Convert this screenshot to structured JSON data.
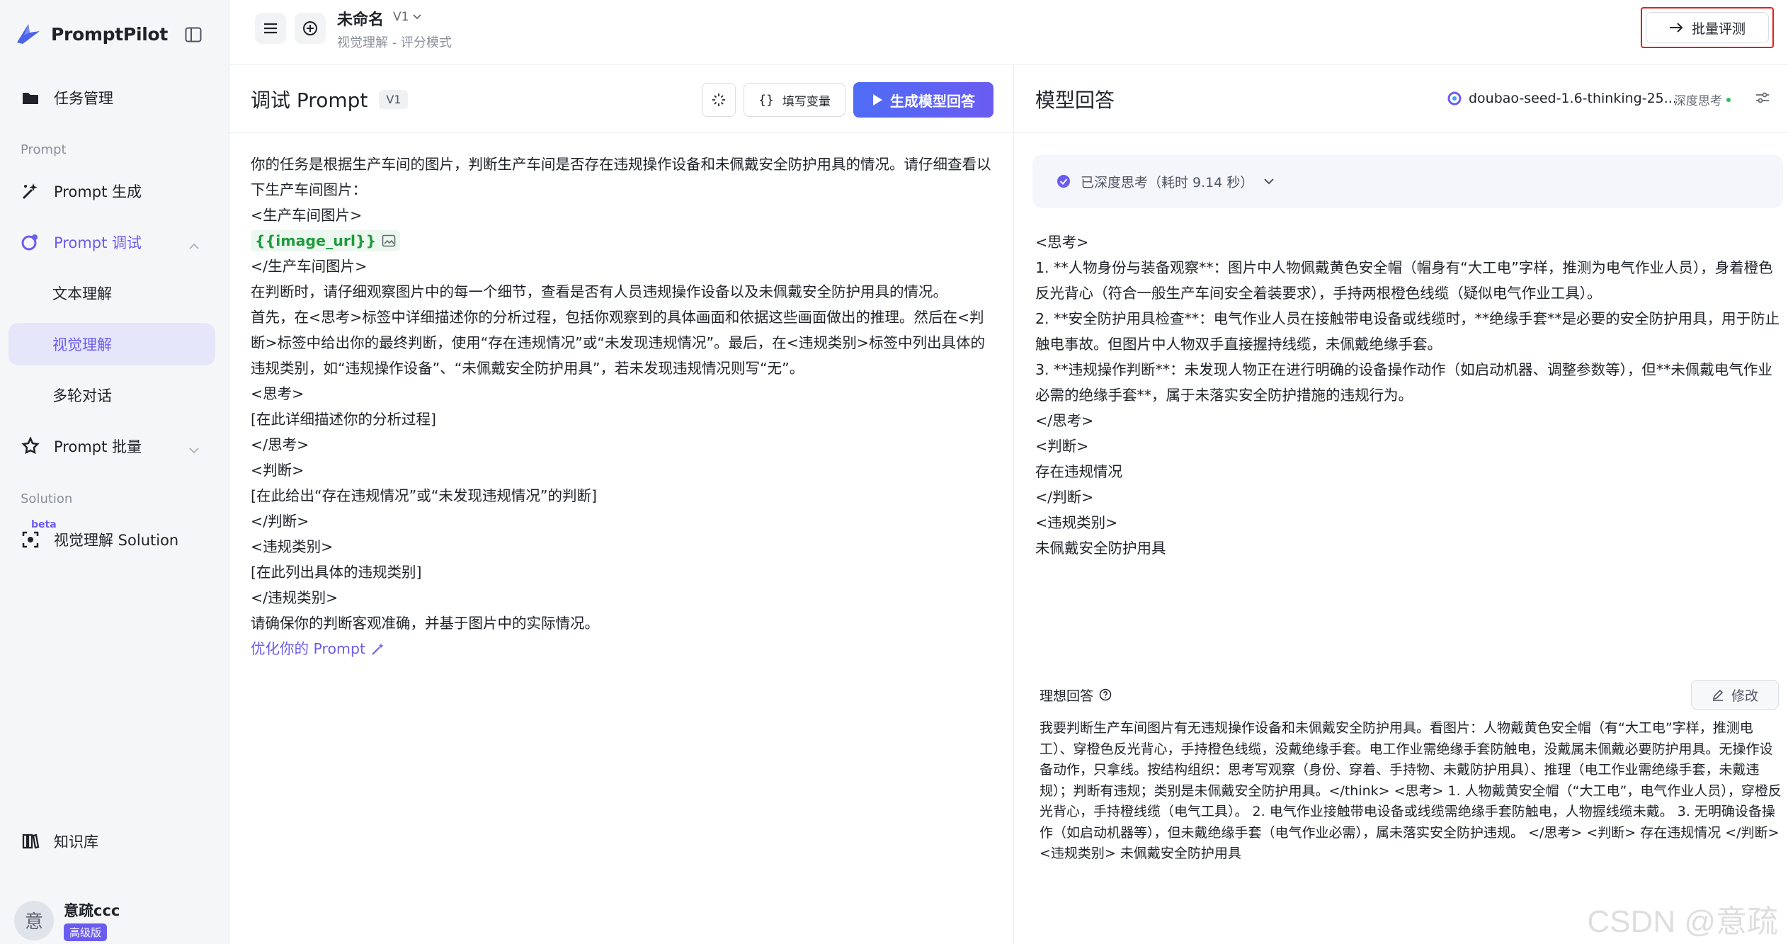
{
  "app": {
    "name": "PromptPilot"
  },
  "sidebar": {
    "task_mgmt": "任务管理",
    "section_prompt": "Prompt",
    "prompt_gen": "Prompt 生成",
    "prompt_debug": "Prompt 调试",
    "sub_text": "文本理解",
    "sub_vision": "视觉理解",
    "sub_multi": "多轮对话",
    "prompt_batch": "Prompt 批量",
    "section_solution": "Solution",
    "beta": "beta",
    "vision_solution": "视觉理解 Solution",
    "knowledge": "知识库",
    "user_name": "意疏ccc",
    "user_initial": "意",
    "plan": "高级版"
  },
  "topbar": {
    "title": "未命名",
    "version": "V1",
    "subtitle": "视觉理解 - 评分模式",
    "batch_eval": "批量评测"
  },
  "prompt_panel": {
    "title": "调试 Prompt",
    "version": "V1",
    "fill_vars": "填写变量",
    "generate": "生成模型回答",
    "lines": [
      "你的任务是根据生产车间的图片，判断生产车间是否存在违规操作设备和未佩戴安全防护用具的情况。请仔细查看以下生产车间图片：",
      "<生产车间图片>"
    ],
    "image_var": "{{image_url}}",
    "lines2": [
      "</生产车间图片>",
      "在判断时，请仔细观察图片中的每一个细节，查看是否有人员违规操作设备以及未佩戴安全防护用具的情况。",
      "首先，在<思考>标签中详细描述你的分析过程，包括你观察到的具体画面和依据这些画面做出的推理。然后在<判断>标签中给出你的最终判断，使用“存在违规情况”或“未发现违规情况”。最后，在<违规类别>标签中列出具体的违规类别，如“违规操作设备”、“未佩戴安全防护用具”，若未发现违规情况则写“无”。",
      "<思考>",
      "[在此详细描述你的分析过程]",
      "</思考>",
      "<判断>",
      "[在此给出“存在违规情况”或“未发现违规情况”的判断]",
      "</判断>",
      "<违规类别>",
      "[在此列出具体的违规类别]",
      "</违规类别>",
      "请确保你的判断客观准确，并基于图片中的实际情况。"
    ],
    "optimize": "优化你的 Prompt"
  },
  "response_panel": {
    "title": "模型回答",
    "model": "doubao-seed-1.6-thinking-25...",
    "deep_think": "深度思考",
    "thought_status": "已深度思考（耗时 9.14 秒）",
    "lines": [
      "<思考>",
      "1. **人物身份与装备观察**：图片中人物佩戴黄色安全帽（帽身有“大工电”字样，推测为电气作业人员），身着橙色反光背心（符合一般生产车间安全着装要求），手持两根橙色线缆（疑似电气作业工具）。",
      "2. **安全防护用具检查**：电气作业人员在接触带电设备或线缆时，**绝缘手套**是必要的安全防护用具，用于防止触电事故。但图片中人物双手直接握持线缆，未佩戴绝缘手套。",
      "3. **违规操作判断**：未发现人物正在进行明确的设备操作动作（如启动机器、调整参数等），但**未佩戴电气作业必需的绝缘手套**，属于未落实安全防护措施的违规行为。",
      "</思考>",
      "<判断>",
      "存在违规情况",
      "</判断>",
      "<违规类别>",
      "未佩戴安全防护用具"
    ],
    "ideal_label": "理想回答",
    "edit": "修改",
    "ideal_text": "我要判断生产车间图片有无违规操作设备和未佩戴安全防护用具。看图片：人物戴黄色安全帽（有“大工电”字样，推测电工）、穿橙色反光背心，手持橙色线缆，没戴绝缘手套。电工作业需绝缘手套防触电，没戴属未佩戴必要防护用具。无操作设备动作，只拿线。按结构组织：思考写观察（身份、穿着、手持物、未戴防护用具）、推理（电工作业需绝缘手套，未戴违规）；判断有违规；类别是未佩戴安全防护用具。</think> <思考> 1. 人物戴黄安全帽（“大工电”，电气作业人员），穿橙反光背心，手持橙线缆（电气工具）。 2. 电气作业接触带电设备或线缆需绝缘手套防触电，人物握线缆未戴。 3. 无明确设备操作（如启动机器等），但未戴绝缘手套（电气作业必需），属未落实安全防护违规。 </思考> <判断> 存在违规情况 </判断> <违规类别> 未佩戴安全防护用具",
    "watermark": "CSDN @意疏"
  },
  "colors": {
    "accent": "#6b5cf0",
    "highlight_box": "#e02020",
    "var_green": "#1f9a3e"
  }
}
